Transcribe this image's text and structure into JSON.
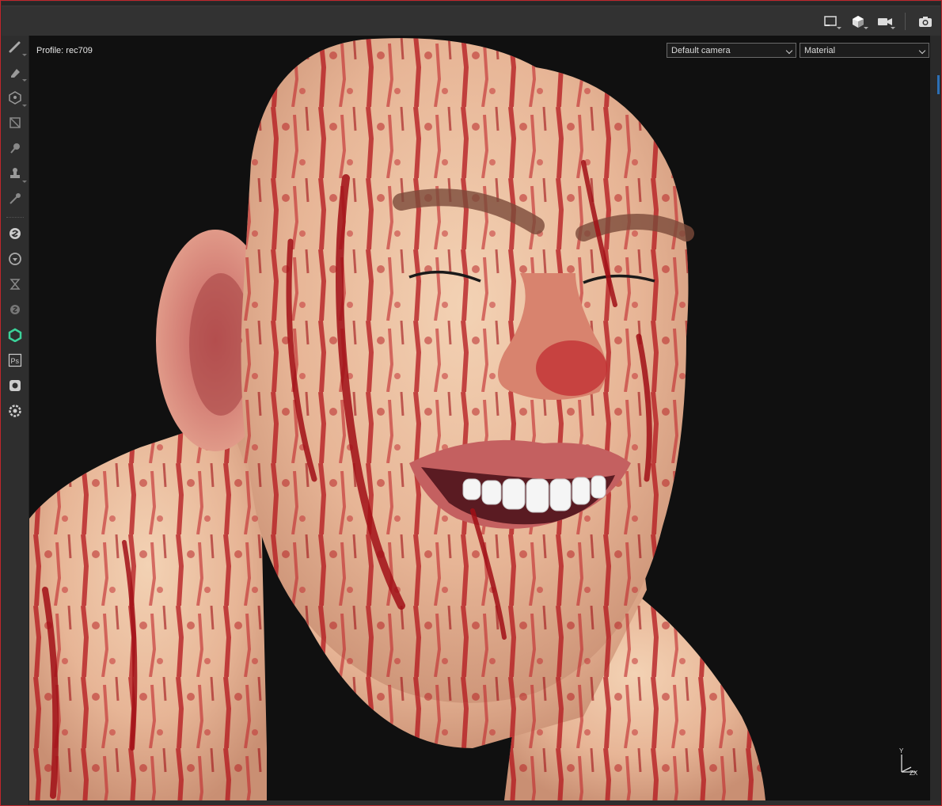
{
  "viewport": {
    "profile_label": "Profile: rec709",
    "camera_select": {
      "selected": "Default camera"
    },
    "mode_select": {
      "selected": "Material"
    },
    "axis": {
      "y": "Y",
      "zx": "ZX"
    }
  },
  "top_toolbar": {
    "icons": [
      "viewport-layout-icon",
      "cube-view-icon",
      "camera-icon",
      "screenshot-icon"
    ]
  },
  "left_toolbar": {
    "tools": [
      "paint-brush-icon",
      "eraser-icon",
      "projection-icon",
      "polygon-fill-icon",
      "smudge-icon",
      "clone-stamp-icon",
      "color-picker-icon",
      "substance-icon",
      "bakery-icon",
      "iray-icon",
      "substance-grey-icon",
      "share-icon",
      "photoshop-icon",
      "send-to-icon",
      "settings-icon"
    ],
    "ps_label": "Ps"
  },
  "colors": {
    "skin": "#e8b89a",
    "blood": "#b3151c",
    "viewport_bg": "#101010",
    "frame_border": "#c0262c"
  }
}
